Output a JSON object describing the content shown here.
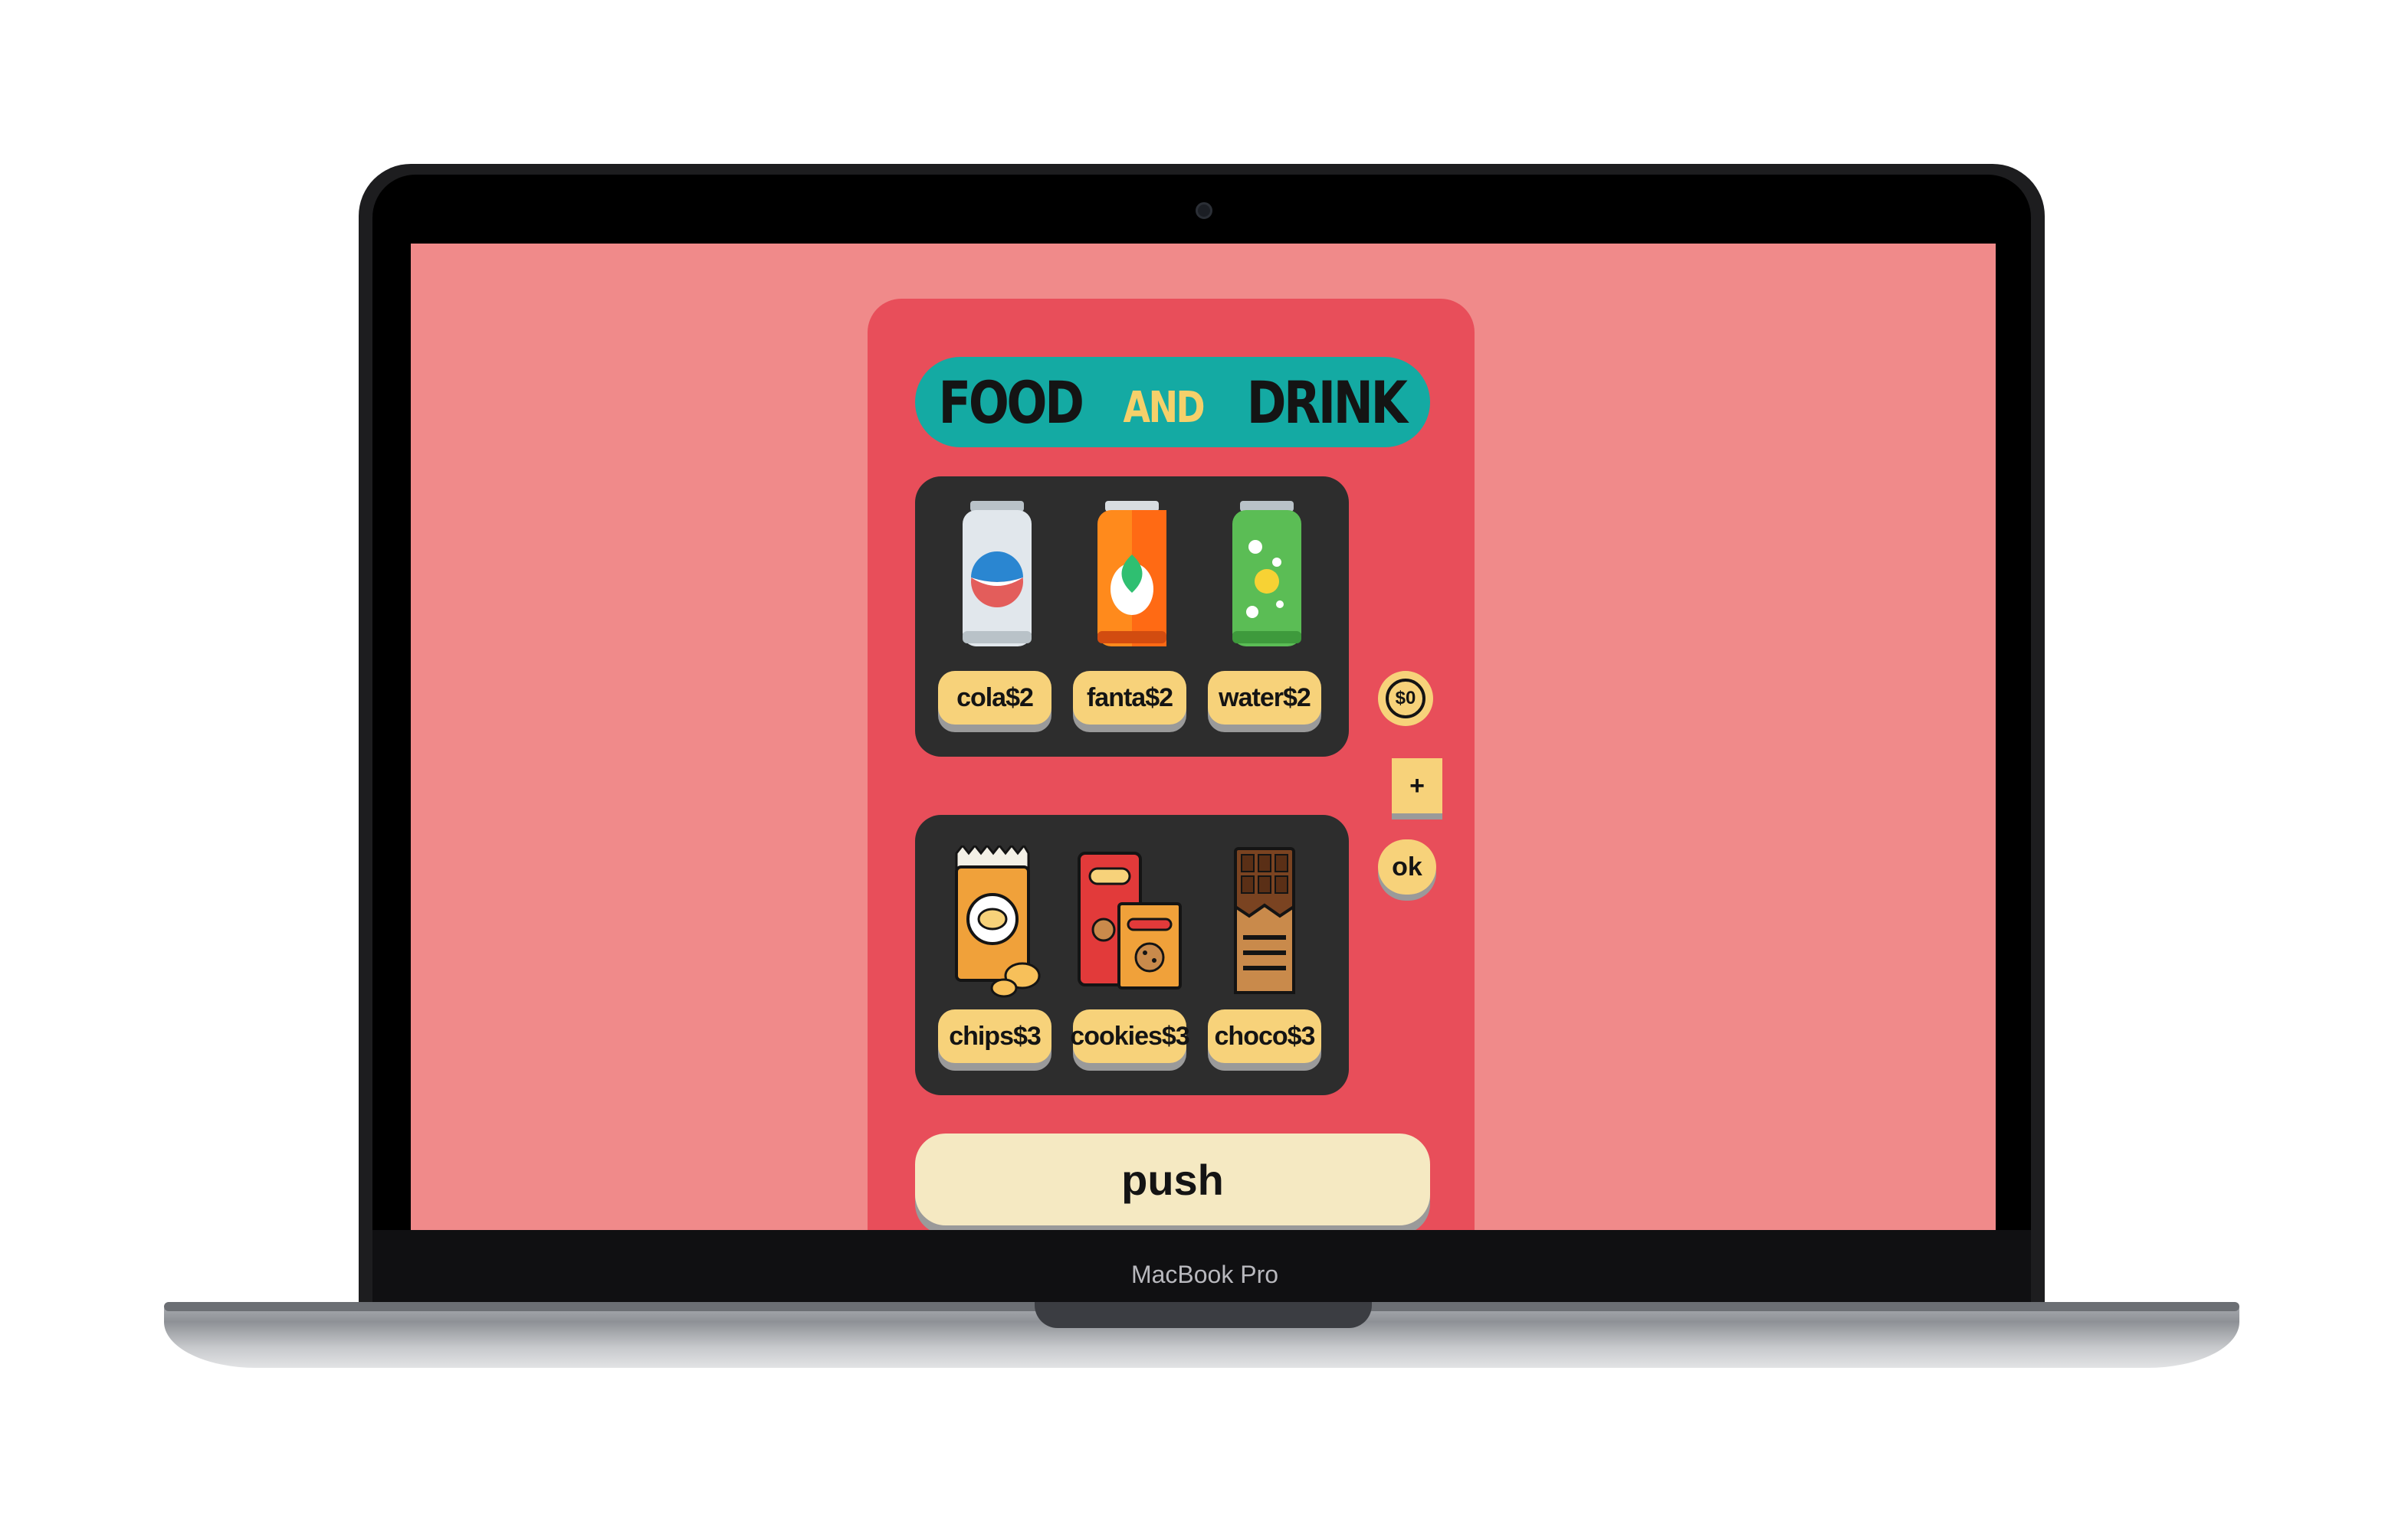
{
  "laptop": {
    "brand_label": "MacBook Pro"
  },
  "machine": {
    "title": {
      "word1": "FOOD",
      "word2": "AND",
      "word3": "DRINK"
    },
    "drinks": [
      {
        "label": "cola$2",
        "icon": "cola-can-icon"
      },
      {
        "label": "fanta$2",
        "icon": "fanta-can-icon"
      },
      {
        "label": "water$2",
        "icon": "water-can-icon"
      }
    ],
    "snacks": [
      {
        "label": "chips$3",
        "icon": "chips-bag-icon"
      },
      {
        "label": "cookies$3",
        "icon": "cookies-box-icon"
      },
      {
        "label": "choco$3",
        "icon": "chocolate-bar-icon"
      }
    ],
    "balance": "$0",
    "plus_label": "+",
    "ok_label": "ok",
    "push_label": "push"
  },
  "colors": {
    "screen_bg": "#f08a8a",
    "machine_body": "#e84e5a",
    "title_bar": "#14aaa3",
    "title_accent": "#f5d06a",
    "shelf": "#2d2d2d",
    "button": "#f7d27a",
    "push_button": "#f5e9c2"
  }
}
